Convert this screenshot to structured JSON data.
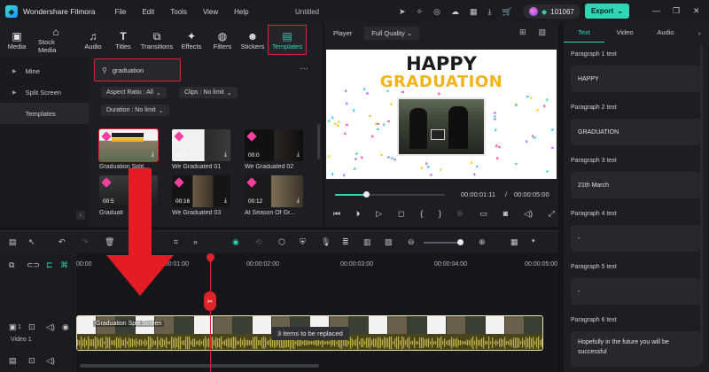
{
  "app": {
    "name": "Wondershare Filmora",
    "menus": [
      "File",
      "Edit",
      "Tools",
      "View",
      "Help"
    ],
    "document_title": "Untitled",
    "credits": "101067",
    "export_label": "Export"
  },
  "toolbar": {
    "tools": [
      {
        "label": "Media",
        "icon": "media-icon"
      },
      {
        "label": "Stock Media",
        "icon": "stock-media-icon"
      },
      {
        "label": "Audio",
        "icon": "audio-icon"
      },
      {
        "label": "Titles",
        "icon": "titles-icon"
      },
      {
        "label": "Transitions",
        "icon": "transitions-icon"
      },
      {
        "label": "Effects",
        "icon": "effects-icon"
      },
      {
        "label": "Filters",
        "icon": "filters-icon"
      },
      {
        "label": "Stickers",
        "icon": "stickers-icon"
      },
      {
        "label": "Templates",
        "icon": "templates-icon",
        "active": true
      }
    ]
  },
  "sidebar": {
    "items": [
      {
        "label": "Mine"
      },
      {
        "label": "Split Screen"
      },
      {
        "label": "Templates",
        "active": true
      }
    ]
  },
  "media": {
    "search_value": "graduation",
    "filters": {
      "aspect_ratio": "Aspect Ratio : All",
      "clips": "Clips : No limit",
      "duration": "Duration : No limit"
    },
    "templates": [
      {
        "caption": "Graduation Split...",
        "duration": "",
        "selected": true
      },
      {
        "caption": "We Graduated 01",
        "duration": "00:2"
      },
      {
        "caption": "We Graduated 02",
        "duration": "00:0"
      },
      {
        "caption": "Graduati",
        "duration": "00:5"
      },
      {
        "caption": "We Graduated 03",
        "duration": "00:16"
      },
      {
        "caption": "At Season Of Gr...",
        "duration": "00:12"
      }
    ]
  },
  "player": {
    "label": "Player",
    "quality": "Full Quality",
    "preview_text_1": "HAPPY",
    "preview_text_2": "GRADUATION",
    "current_time": "00:00:01:11",
    "separator": "/",
    "total_time": "00:00:05:00",
    "progress": 0.28
  },
  "right_panel": {
    "tabs": [
      "Text",
      "Video",
      "Audio"
    ],
    "active_tab": "Text",
    "paragraphs": [
      {
        "label": "Paragraph 1 text",
        "value": "HAPPY"
      },
      {
        "label": "Paragraph 2 text",
        "value": "GRADUATION"
      },
      {
        "label": "Paragraph 3 text",
        "value": "21th March"
      },
      {
        "label": "Paragraph 4 text",
        "value": "-"
      },
      {
        "label": "Paragraph 5 text",
        "value": "-"
      },
      {
        "label": "Paragraph 6 text",
        "value": "Hopefully in the future you will be successful"
      }
    ]
  },
  "timeline": {
    "ruler": [
      "00:00",
      "00:00:01:00",
      "00:00:02:00",
      "00:00:03:00",
      "00:00:04:00",
      "00:00:05:00"
    ],
    "clip_title": "Graduation Split Screen",
    "toast": "3 items to be replaced",
    "track_label": "Video 1",
    "track_number": "1"
  },
  "colors": {
    "accent": "#2fd6b4",
    "highlight": "#e0222a",
    "arrow": "#e41c23",
    "gold": "#f3b31a"
  }
}
